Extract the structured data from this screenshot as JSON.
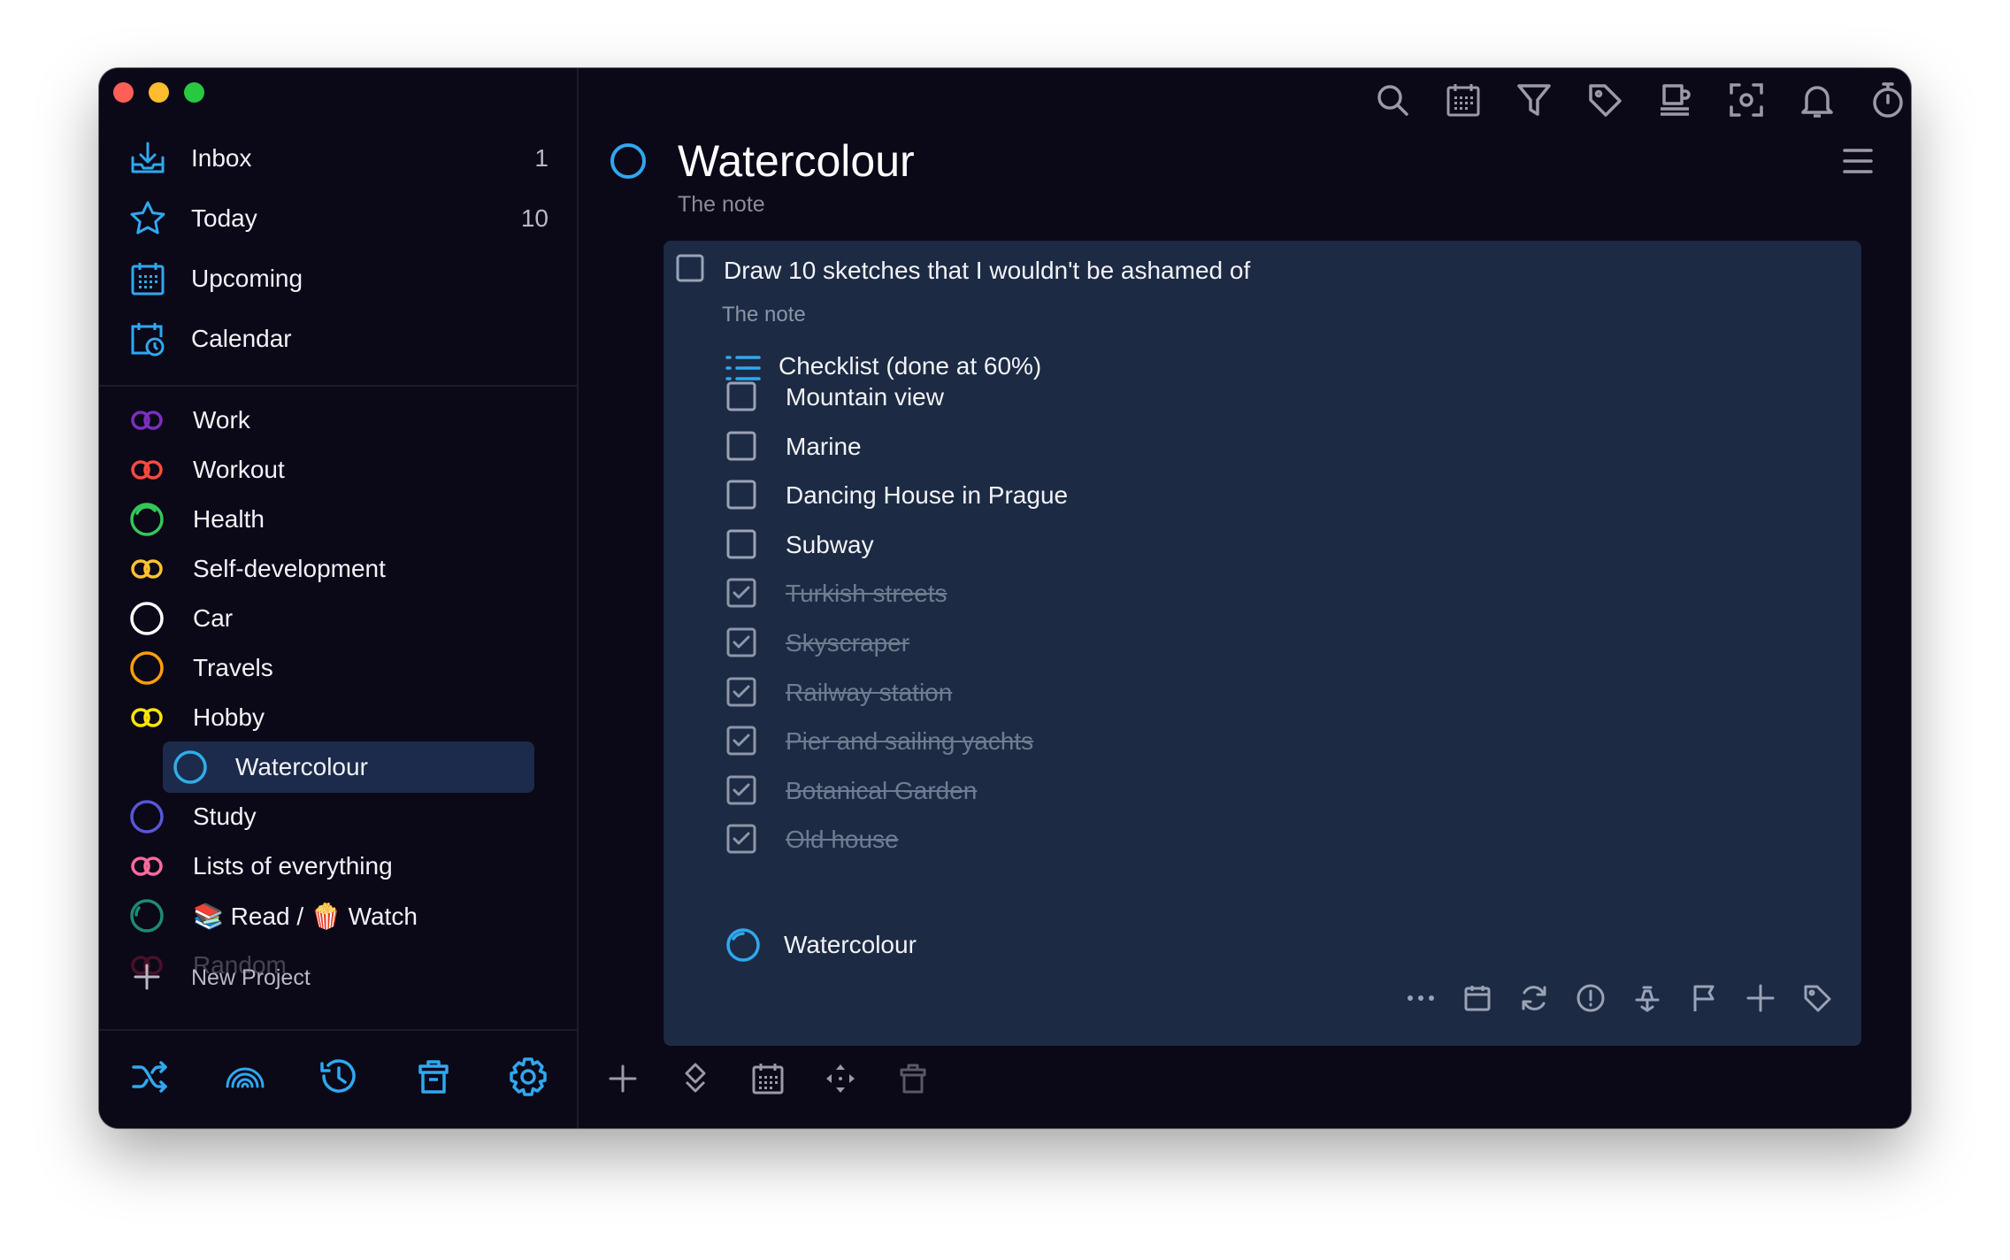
{
  "sidebar": {
    "nav": [
      {
        "label": "Inbox",
        "count": "1",
        "icon": "inbox-icon"
      },
      {
        "label": "Today",
        "count": "10",
        "icon": "star-icon"
      },
      {
        "label": "Upcoming",
        "count": "",
        "icon": "calendar-grid-icon"
      },
      {
        "label": "Calendar",
        "count": "",
        "icon": "calendar-clock-icon"
      }
    ],
    "projects": [
      {
        "label": "Work",
        "color": "#7b2fbe"
      },
      {
        "label": "Workout",
        "color": "#ff4b3e"
      },
      {
        "label": "Health",
        "color": "#34c759"
      },
      {
        "label": "Self-development",
        "color": "#ffc233"
      },
      {
        "label": "Car",
        "color": "#ffffff"
      },
      {
        "label": "Travels",
        "color": "#ff9f0a"
      },
      {
        "label": "Hobby",
        "color": "#ffe600"
      },
      {
        "label": "Watercolour",
        "color": "#32ade6"
      },
      {
        "label": "Study",
        "color": "#5856d6"
      },
      {
        "label": "Lists of everything",
        "color": "#ff6b9d"
      },
      {
        "label_read": "Read /",
        "label_watch": "Watch",
        "color": "#1f8a70"
      },
      {
        "label": "Random",
        "color": "#ff2d55"
      }
    ],
    "new_project_label": "New Project"
  },
  "main": {
    "project_title": "Watercolour",
    "project_note": "The note",
    "task": {
      "title": "Draw 10 sketches that I wouldn't be ashamed of",
      "note": "The note",
      "checklist_title": "Checklist (done at 60%)",
      "checklist": [
        {
          "text": "Mountain view",
          "done": false
        },
        {
          "text": "Marine",
          "done": false
        },
        {
          "text": "Dancing House in Prague",
          "done": false
        },
        {
          "text": "Subway",
          "done": false
        },
        {
          "text": "Turkish streets",
          "done": true
        },
        {
          "text": "Skyscraper",
          "done": true
        },
        {
          "text": "Railway station",
          "done": true
        },
        {
          "text": "Pier and sailing yachts",
          "done": true
        },
        {
          "text": "Botanical Garden",
          "done": true
        },
        {
          "text": "Old house",
          "done": true
        }
      ],
      "subproject": "Watercolour"
    }
  },
  "colors": {
    "accent": "#2fa8f0",
    "background": "#0b0818",
    "card": "#1c2a43",
    "selected": "#1c2b4b"
  }
}
